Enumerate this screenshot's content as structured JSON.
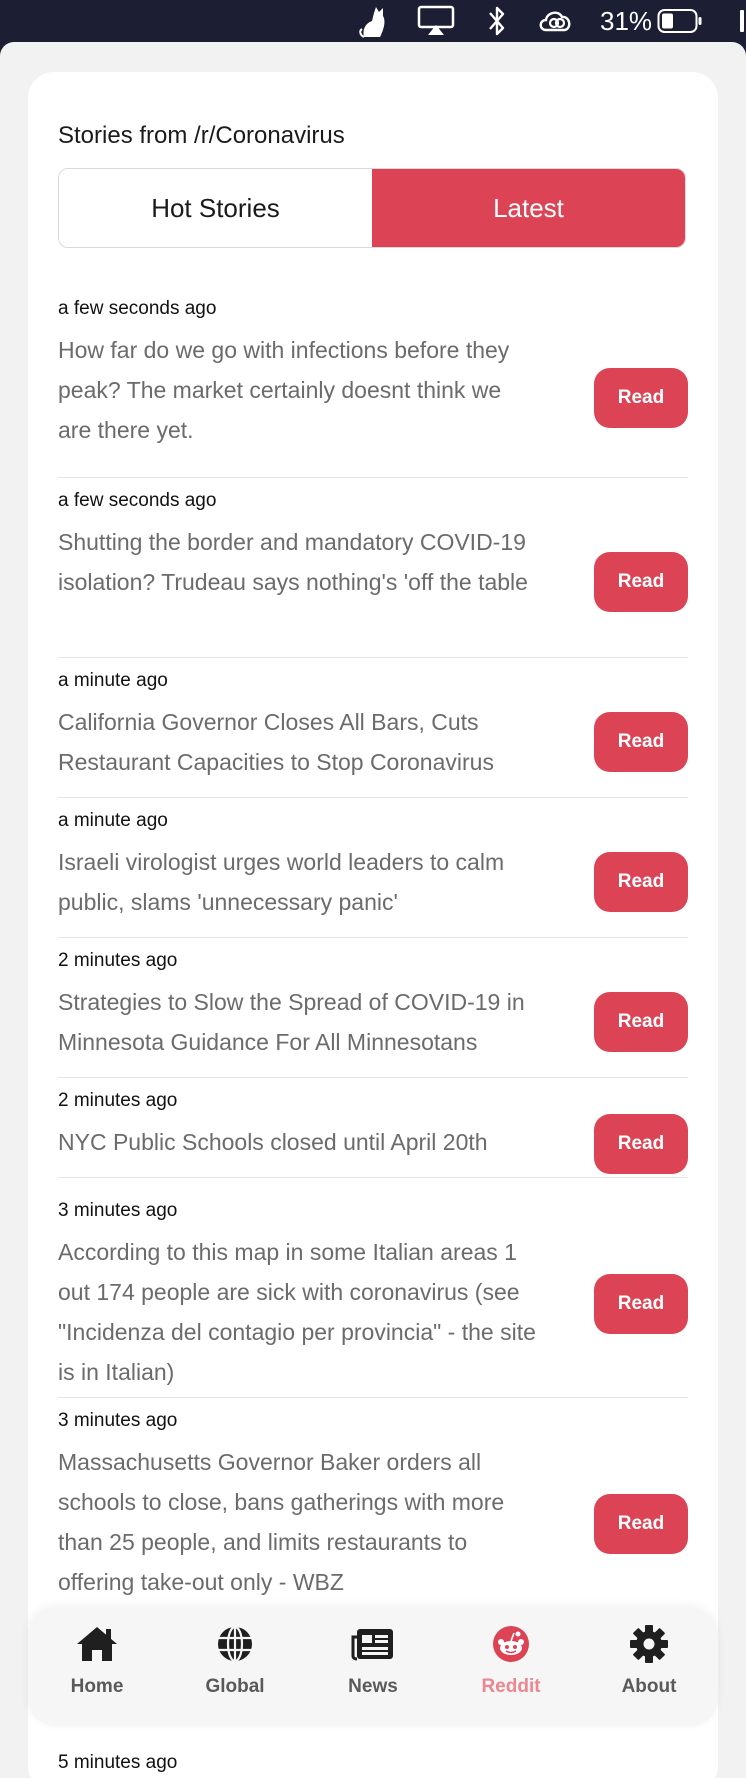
{
  "status_bar": {
    "battery_percent": "31%",
    "icons": [
      "cat-icon",
      "airplay-icon",
      "bluetooth-icon",
      "creative-cloud-icon",
      "battery-icon"
    ]
  },
  "header": {
    "title": "Stories from /r/Coronavirus"
  },
  "tabs": [
    {
      "label": "Hot Stories",
      "active": false
    },
    {
      "label": "Latest",
      "active": true
    }
  ],
  "read_label": "Read",
  "stories": [
    {
      "time": "a few seconds ago",
      "title": "How far do we go with infections before they peak? The market certainly doesnt think we are there yet."
    },
    {
      "time": "a few seconds ago",
      "title": "Shutting the border and mandatory COVID-19 isolation? Trudeau says nothing's 'off the table"
    },
    {
      "time": "a minute ago",
      "title": "California Governor Closes All Bars, Cuts Restaurant Capacities to Stop Coronavirus"
    },
    {
      "time": "a minute ago",
      "title": "Israeli virologist urges world leaders to calm public, slams 'unnecessary panic'"
    },
    {
      "time": "2 minutes ago",
      "title": "Strategies to Slow the Spread of COVID-19 in Minnesota Guidance For All Minnesotans"
    },
    {
      "time": "2 minutes ago",
      "title": "NYC Public Schools closed until April 20th"
    },
    {
      "time": "3 minutes ago",
      "title": "According to this map in some Italian areas 1 out 174 people are sick with coronavirus (see \"Incidenza del contagio per provincia\" - the site is in Italian)"
    },
    {
      "time": "3 minutes ago",
      "title": "Massachusetts Governor Baker orders all schools to close, bans gatherings with more than 25 people, and limits restaurants to offering take-out only - WBZ"
    }
  ],
  "next_story_time": "5 minutes ago",
  "nav": [
    {
      "label": "Home",
      "icon": "home-icon",
      "active": false
    },
    {
      "label": "Global",
      "icon": "globe-icon",
      "active": false
    },
    {
      "label": "News",
      "icon": "newspaper-icon",
      "active": false
    },
    {
      "label": "Reddit",
      "icon": "reddit-icon",
      "active": true
    },
    {
      "label": "About",
      "icon": "gear-icon",
      "active": false
    }
  ],
  "colors": {
    "accent": "#dc4456",
    "active_nav": "#ea8791",
    "status_bar": "#1c1f33"
  }
}
